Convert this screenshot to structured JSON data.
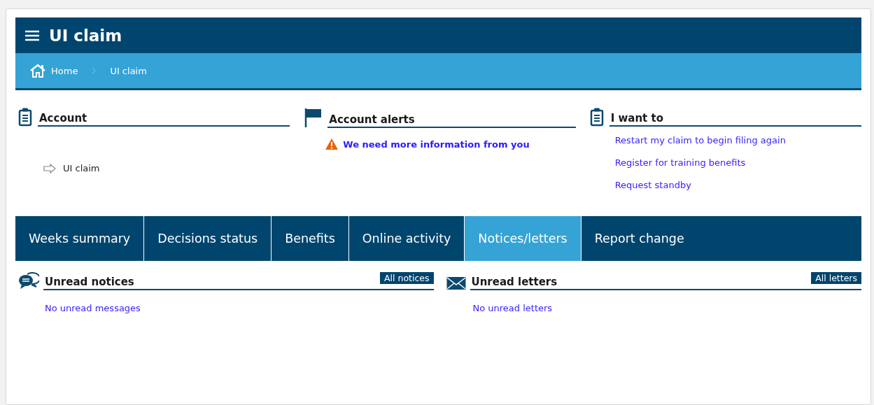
{
  "header": {
    "title": "UI claim"
  },
  "breadcrumb": [
    {
      "label": "Home"
    },
    {
      "label": "UI claim"
    }
  ],
  "panels": [
    {
      "kind": "account",
      "title": "Account",
      "links": [
        "UI claim"
      ]
    },
    {
      "kind": "alerts",
      "title": "Account alerts",
      "links": [
        "We need more information from you"
      ]
    },
    {
      "kind": "actions",
      "title": "I want to",
      "links": [
        "Restart my claim to begin filing again",
        "Register for training benefits",
        "Request standby"
      ]
    }
  ],
  "tabs": [
    {
      "label": "Weeks summary",
      "selected": false
    },
    {
      "label": "Decisions status",
      "selected": false
    },
    {
      "label": "Benefits",
      "selected": false
    },
    {
      "label": "Online activity",
      "selected": false
    },
    {
      "label": "Notices/letters",
      "selected": true
    },
    {
      "label": "Report change",
      "selected": false
    }
  ],
  "sections": [
    {
      "kind": "notices",
      "title": "Unread notices",
      "button": "All notices",
      "message": "No unread messages"
    },
    {
      "kind": "letters",
      "title": "Unread letters",
      "button": "All letters",
      "message": "No unread letters"
    }
  ]
}
